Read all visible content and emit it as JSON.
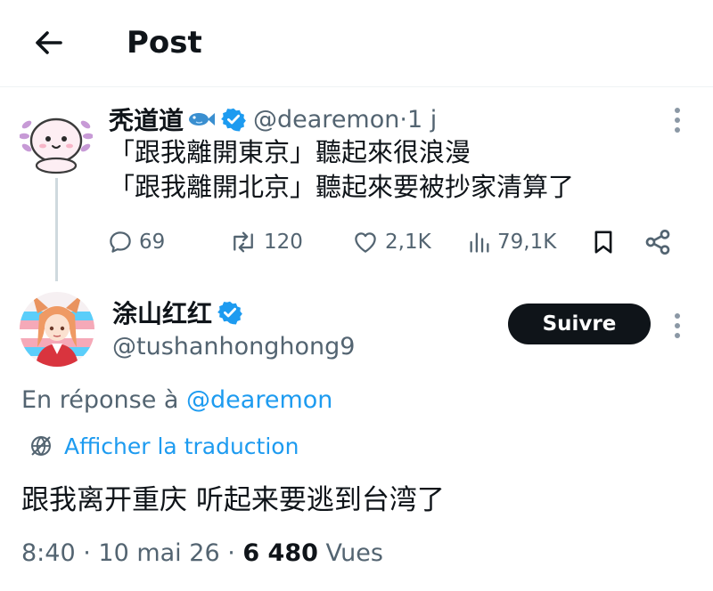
{
  "header": {
    "title": "Post",
    "back_icon": "arrow-left-icon"
  },
  "parent_post": {
    "display_name": "秃道道",
    "name_emoji": "fish-emoji",
    "verified_color": "#1d9bf0",
    "handle": "@dearemon",
    "separator": " · ",
    "time": "1 j",
    "avatar_icon": "axolotl-avatar",
    "lines": [
      "「跟我離開東京」聽起來很浪漫",
      "「跟我離開北京」聽起來要被抄家清算了"
    ],
    "actions": {
      "replies": "69",
      "reposts": "120",
      "likes": "2,1K",
      "views": "79,1K",
      "bookmark_icon": "bookmark-icon",
      "share_icon": "share-icon"
    }
  },
  "reply_post": {
    "display_name": "涂山红红",
    "verified_color": "#1d9bf0",
    "handle": "@tushanhonghong9",
    "follow_label": "Suivre",
    "reply_prefix": "En réponse à ",
    "reply_handle": "@dearemon",
    "translate_label": "Afficher la traduction",
    "text": "跟我离开重庆 听起来要逃到台湾了",
    "time": "8:40",
    "date": "10 mai 26",
    "separator": " · ",
    "views_count": "6 480",
    "views_label": " Vues"
  },
  "colors": {
    "accent": "#1d9bf0",
    "text": "#0f1419",
    "muted": "#536471",
    "button": "#0f1419"
  }
}
